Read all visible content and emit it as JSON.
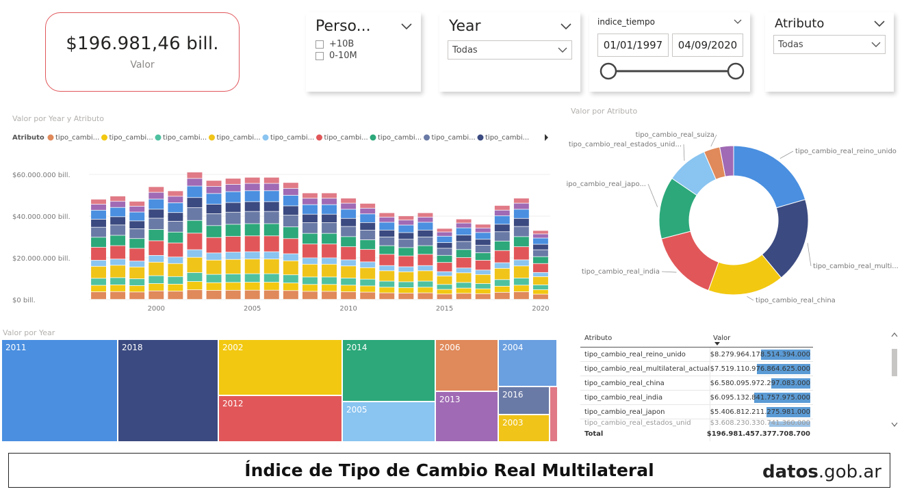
{
  "card": {
    "value": "$196.981,46 bill.",
    "label": "Valor"
  },
  "slicers": {
    "person": {
      "title": "Perso...",
      "options": [
        "+10B",
        "0-10M"
      ]
    },
    "year": {
      "title": "Year",
      "selected": "Todas"
    },
    "indice": {
      "title": "indice_tiempo",
      "start": "01/01/1997",
      "end": "04/09/2020"
    },
    "atributo": {
      "title": "Atributo",
      "selected": "Todas"
    }
  },
  "colors": {
    "orange": "#E0895A",
    "yellow": "#F2C811",
    "teal": "#4FC1A1",
    "gold": "#F0C419",
    "lightblue": "#8AC4F0",
    "red": "#E15759",
    "green": "#2CA87A",
    "slate": "#6A7AA6",
    "navy": "#3B4A80",
    "blue": "#4A8FE0",
    "purple": "#A06AB4",
    "pink": "#E07A86"
  },
  "chart_data": [
    {
      "type": "bar",
      "stacked": true,
      "title": "Valor por Year y Atributo",
      "legend_title": "Atributo",
      "legend_labels": [
        "tipo_cambi...",
        "tipo_cambi...",
        "tipo_cambi...",
        "tipo_cambi...",
        "tipo_cambi...",
        "tipo_cambi...",
        "tipo_cambi...",
        "tipo_cambi...",
        "tipo_cambi..."
      ],
      "x_ticks": [
        2000,
        2005,
        2010,
        2015,
        2020
      ],
      "y_ticks": [
        "$0 bill.",
        "$20.000.000 bill.",
        "$40.000.000 bill.",
        "$60.000.000 bill."
      ],
      "ylim": [
        0,
        60000000
      ],
      "years": [
        1997,
        1998,
        1999,
        2000,
        2001,
        2002,
        2003,
        2004,
        2005,
        2006,
        2007,
        2008,
        2009,
        2010,
        2011,
        2012,
        2013,
        2014,
        2015,
        2016,
        2017,
        2018,
        2019,
        2020
      ],
      "totals": [
        48000000,
        49500000,
        47000000,
        54000000,
        52000000,
        61000000,
        57000000,
        58000000,
        58500000,
        58500000,
        56000000,
        51000000,
        51000000,
        48500000,
        46000000,
        41500000,
        40000000,
        41500000,
        34000000,
        38500000,
        36000000,
        45000000,
        48500000,
        33000000
      ]
    },
    {
      "type": "pie",
      "donut": true,
      "title": "Valor por Atributo",
      "labels": [
        "tipo_cambio_real_reino_unido",
        "tipo_cambio_real_multi...",
        "tipo_cambio_real_china",
        "tipo_cambio_real_india",
        "tipo_cambio_real_japo...",
        "tipo_cambio_real_estados_unid...",
        "tipo_cambio_real_suiza",
        ""
      ],
      "values": [
        20.5,
        18.5,
        16.5,
        15.5,
        13.5,
        9,
        3.5,
        3
      ]
    },
    {
      "type": "treemap",
      "title": "Valor por Year",
      "labels": [
        "2011",
        "2018",
        "2002",
        "2012",
        "2014",
        "2005",
        "2006",
        "2013",
        "2004",
        "2016",
        "2003"
      ]
    }
  ],
  "table": {
    "headers": [
      "Atributo",
      "Valor"
    ],
    "rows": [
      {
        "name": "tipo_cambio_real_reino_unido",
        "value": "$8.279.964.178.514.394.000",
        "frac": 0.48
      },
      {
        "name": "tipo_cambio_real_multilateral_actual",
        "value": "$7.519.110.976.864.625.000",
        "frac": 0.52
      },
      {
        "name": "tipo_cambio_real_china",
        "value": "$6.580.095.972.297.083.000",
        "frac": 0.38
      },
      {
        "name": "tipo_cambio_real_india",
        "value": "$6.095.132.841.757.975.000",
        "frac": 0.55
      },
      {
        "name": "tipo_cambio_real_japon",
        "value": "$5.406.812.211.275.981.000",
        "frac": 0.43
      }
    ],
    "total_label": "Total",
    "total_value": "$196.981.457.377.708.700"
  },
  "footer": {
    "title": "Índice de Tipo de Cambio Real Multilateral",
    "brand_bold": "datos",
    "brand_rest": ".gob.ar"
  }
}
